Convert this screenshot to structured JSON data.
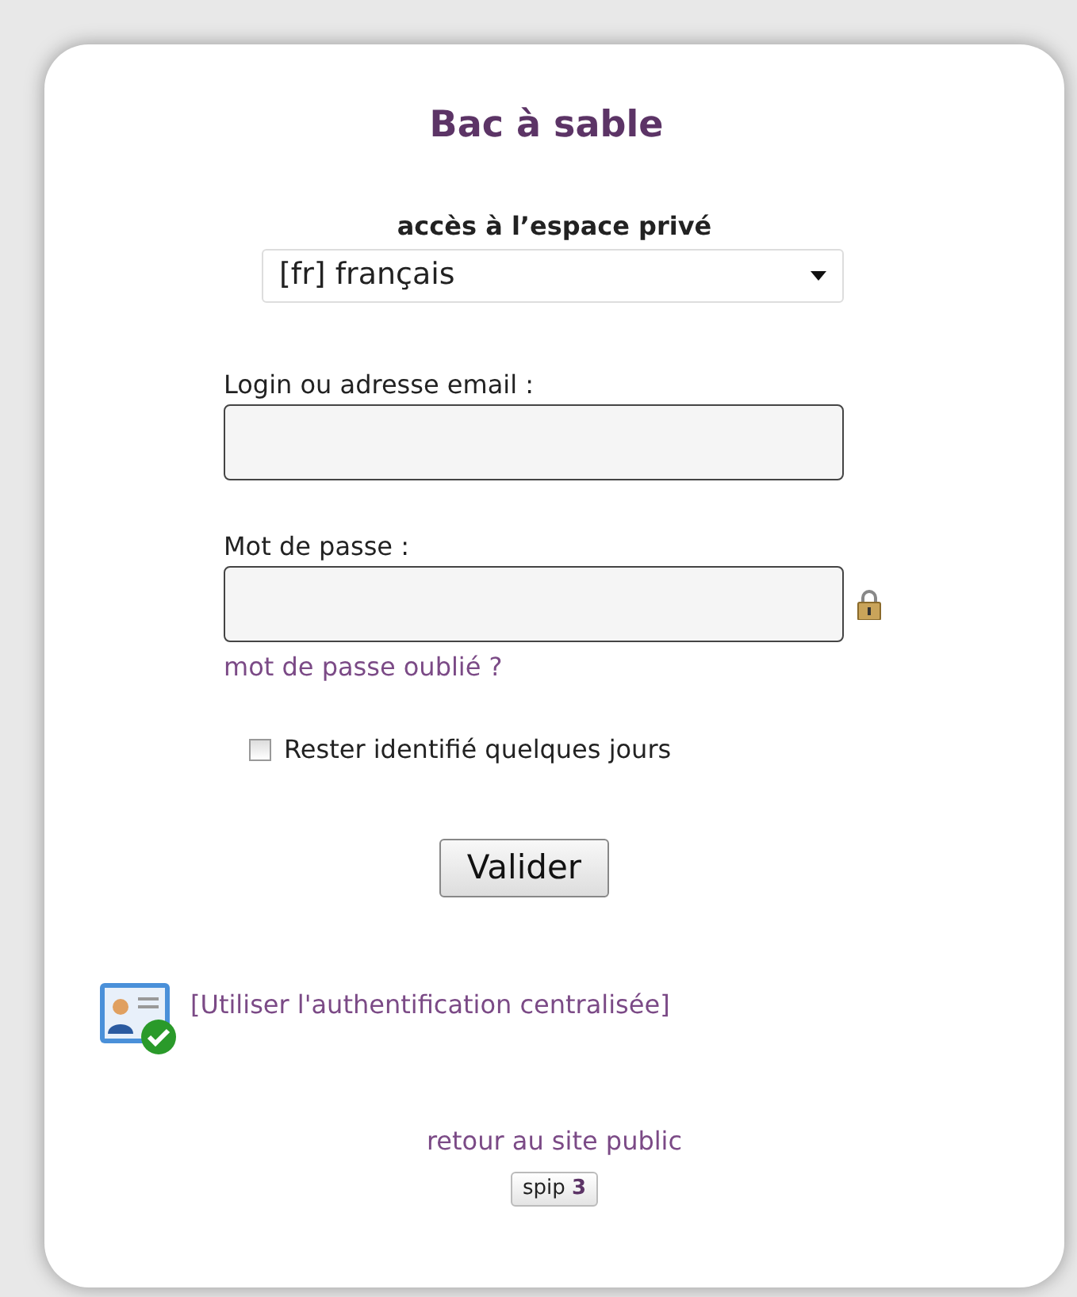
{
  "site_title": "Bac à sable",
  "heading": "accès à l’espace privé",
  "language_select": {
    "value": "[fr] français"
  },
  "fields": [
    {
      "label": "Login ou adresse email :",
      "kind": "text"
    },
    {
      "label": "Mot de passe :",
      "kind": "password"
    }
  ],
  "forgot_link": "mot de passe oublié ?",
  "remember": {
    "label": "Rester identifié quelques jours",
    "checked": false
  },
  "submit_button": "Valider",
  "sso_link": "[Utiliser l'authentification centralisée]",
  "public_link": "retour au site public",
  "badge": {
    "text": "spip",
    "version": "3"
  }
}
